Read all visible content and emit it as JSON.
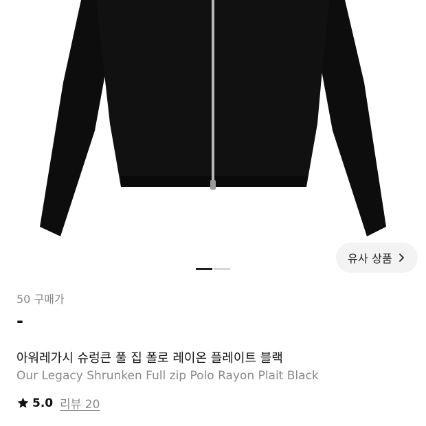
{
  "product": {
    "purchase_count_label": "50 구매가",
    "price": "-",
    "title_ko": "아워레가시 슈렁큰 풀 집 폴로 레이온 플레이트 블랙",
    "title_en": "Our Legacy Shrunken Full zip Polo Rayon Plait Black",
    "rating": "5.0",
    "review_label": "리뷰 20"
  },
  "similar_button": {
    "label": "유사 상품",
    "icon": "chevron-right-icon"
  },
  "carousel": {
    "total": 2,
    "active": 1
  },
  "icons": {
    "rating": "star-icon"
  },
  "colors": {
    "garment": "#0d0d0d",
    "zipper": "#b9b9b9",
    "accent_text": "#111111",
    "muted_text": "#8a8a8a",
    "button_bg": "#f3f3f3"
  }
}
